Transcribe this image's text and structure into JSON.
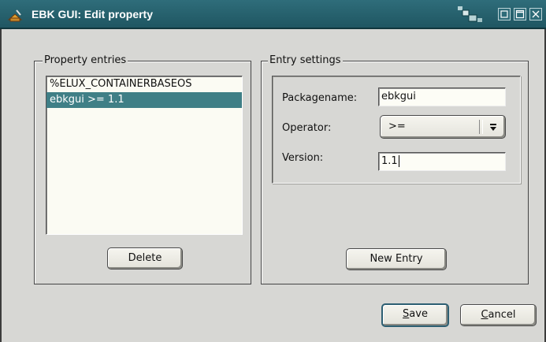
{
  "window": {
    "title": "EBK GUI: Edit property",
    "controls": [
      "minimize-icon",
      "maximize-icon",
      "close-icon"
    ]
  },
  "property_entries": {
    "legend": "Property entries",
    "items": [
      "%ELUX_CONTAINERBASEOS",
      "ebkgui >= 1.1"
    ],
    "selected_index": 1,
    "delete_label": "Delete"
  },
  "entry_settings": {
    "legend": "Entry settings",
    "packagename_label": "Packagename:",
    "packagename_value": "ebkgui",
    "operator_label": "Operator:",
    "operator_value": ">=",
    "version_label": "Version:",
    "version_value": "1.1",
    "new_entry_label": "New Entry"
  },
  "footer": {
    "save_mnemonic": "S",
    "save_rest": "ave",
    "cancel_mnemonic": "C",
    "cancel_rest": "ancel"
  },
  "colors": {
    "titlebar": "#2f6d7a",
    "selection": "#3f7f86",
    "background": "#d7d7d4"
  }
}
